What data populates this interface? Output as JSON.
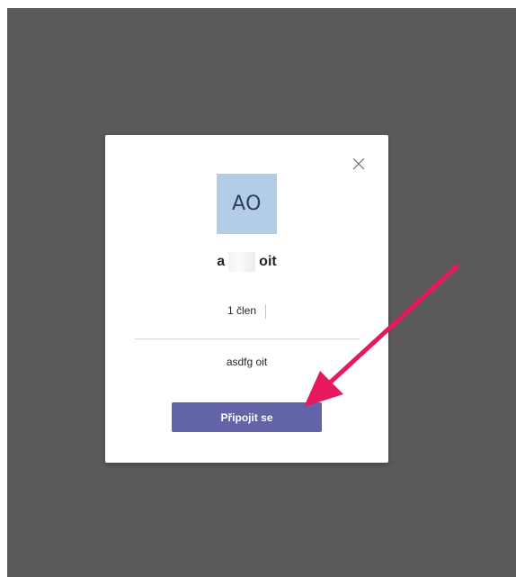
{
  "dialog": {
    "avatar_initials": "AO",
    "team_name_start": "a",
    "team_name_end": "oit",
    "member_count": "1 člen",
    "description": "asdfg oit",
    "join_label": "Připojit se"
  },
  "icons": {
    "close": "close-icon",
    "annotation": "pointer-arrow-icon"
  },
  "colors": {
    "backdrop": "#5b5a59",
    "avatar_bg": "#b4cde6",
    "avatar_text": "#2b3f5e",
    "join_button": "#6264a7",
    "annotation_arrow": "#e8185c"
  }
}
